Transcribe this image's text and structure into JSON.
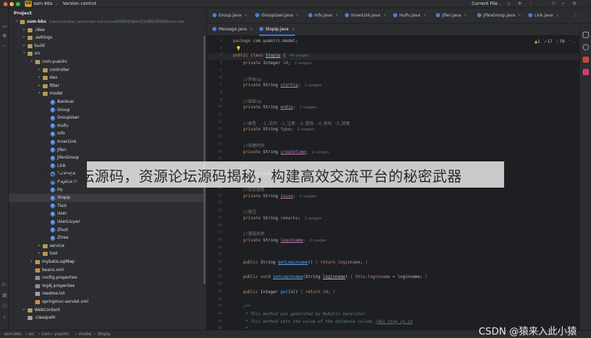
{
  "titlebar": {
    "project_badge": "SB",
    "project_name": "ssm-bbs",
    "vcs": "Version control",
    "run_config": "Current File"
  },
  "project_panel": {
    "title": "Project",
    "rows": [
      {
        "label": "ssm-bbs",
        "path": "/Library/eclipse_space/ssp+vue+mysql实现的在线bbs论坛源码/项目源码/ssm-bbs",
        "kind": "folder",
        "depth": 0,
        "open": true
      },
      {
        "label": ".idea",
        "kind": "folder",
        "depth": 1,
        "open": false
      },
      {
        "label": ".settings",
        "kind": "folder",
        "depth": 1,
        "open": false
      },
      {
        "label": "build",
        "kind": "folder",
        "depth": 1,
        "open": false
      },
      {
        "label": "src",
        "kind": "folder",
        "depth": 1,
        "open": true
      },
      {
        "label": "com.yuanlrc",
        "kind": "folder",
        "depth": 2,
        "open": true
      },
      {
        "label": "controller",
        "kind": "folder",
        "depth": 3,
        "open": false
      },
      {
        "label": "dao",
        "kind": "folder",
        "depth": 3,
        "open": false
      },
      {
        "label": "filter",
        "kind": "folder",
        "depth": 3,
        "open": false
      },
      {
        "label": "model",
        "kind": "folder",
        "depth": 3,
        "open": true
      },
      {
        "label": "Bankuai",
        "kind": "class",
        "depth": 4
      },
      {
        "label": "Group",
        "kind": "class",
        "depth": 4
      },
      {
        "label": "GroupUser",
        "kind": "class",
        "depth": 4
      },
      {
        "label": "Huifu",
        "kind": "class",
        "depth": 4
      },
      {
        "label": "info",
        "kind": "class",
        "depth": 4
      },
      {
        "label": "InnerLink",
        "kind": "class",
        "depth": 4
      },
      {
        "label": "Jifen",
        "kind": "class",
        "depth": 4
      },
      {
        "label": "JifenGroup",
        "kind": "class",
        "depth": 4
      },
      {
        "label": "Link",
        "kind": "class",
        "depth": 4
      },
      {
        "label": "Message",
        "kind": "class",
        "depth": 4
      },
      {
        "label": "PageBean",
        "kind": "class",
        "depth": 4
      },
      {
        "label": "Pic",
        "kind": "class",
        "depth": 4
      },
      {
        "label": "Stopip",
        "kind": "class",
        "depth": 4,
        "selected": true
      },
      {
        "label": "Tiezi",
        "kind": "class",
        "depth": 4
      },
      {
        "label": "User",
        "kind": "class",
        "depth": 4
      },
      {
        "label": "UserLiuyan",
        "kind": "class",
        "depth": 4
      },
      {
        "label": "Zhuti",
        "kind": "class",
        "depth": 4
      },
      {
        "label": "Ztree",
        "kind": "class",
        "depth": 4
      },
      {
        "label": "service",
        "kind": "folder",
        "depth": 3,
        "open": false
      },
      {
        "label": "tool",
        "kind": "folder",
        "depth": 3,
        "open": false
      },
      {
        "label": "mybatis.sqlMap",
        "kind": "folder",
        "depth": 2,
        "open": false
      },
      {
        "label": "beans.xml",
        "kind": "xml",
        "depth": 2
      },
      {
        "label": "config.properties",
        "kind": "prop",
        "depth": 2
      },
      {
        "label": "log4j.properties",
        "kind": "prop",
        "depth": 2
      },
      {
        "label": "readme.txt",
        "kind": "txt",
        "depth": 2
      },
      {
        "label": "springmvc-servlet.xml",
        "kind": "xml",
        "depth": 2
      },
      {
        "label": "WebContent",
        "kind": "folder",
        "depth": 1,
        "open": false
      },
      {
        "label": ".classpath",
        "kind": "txt",
        "depth": 1
      }
    ]
  },
  "tabs_row1": [
    "Group.java",
    "GroupUser.java",
    "Info.java",
    "InnerLink.java",
    "Huifu.java",
    "Jifen.java",
    "JifenGroup.java",
    "Link.java"
  ],
  "tabs_row2": [
    {
      "label": "Message.java",
      "active": false
    },
    {
      "label": "Stopip.java",
      "active": true
    }
  ],
  "inspections": {
    "warnings": "1",
    "weak": "17",
    "typos": "79"
  },
  "code_lines": [
    {
      "n": "1",
      "html": "<span class=\"kw\">package</span> com.yuanlrc.model;"
    },
    {
      "n": "2",
      "html": ""
    },
    {
      "n": "3",
      "html": "<span class=\"kw\">public class</span> <span class=\"ul\">Stopip</span> {<span class=\"hint\">40 usages</span>"
    },
    {
      "n": "4",
      "html": "    <span class=\"kw\">private</span> Integer <span class=\"fd\">id</span>;<span class=\"hint\">2 usages</span>"
    },
    {
      "n": "5",
      "html": ""
    },
    {
      "n": "6",
      "html": "    <span class=\"cm\">//开始ip</span>"
    },
    {
      "n": "7",
      "html": "    <span class=\"kw\">private</span> String <span class=\"fd ul\">startip</span>;<span class=\"hint\">2 usages</span>"
    },
    {
      "n": "8",
      "html": ""
    },
    {
      "n": "9",
      "html": "    <span class=\"cm\">//结束ip</span>"
    },
    {
      "n": "10",
      "html": "    <span class=\"kw\">private</span> String <span class=\"fd ul\">endip</span>;<span class=\"hint\">2 usages</span>"
    },
    {
      "n": "11",
      "html": ""
    },
    {
      "n": "12",
      "html": "    <span class=\"cm\">//类型  -1,访问 -2,注册 -3,登陆 -4,发帖 -5,回复</span>"
    },
    {
      "n": "13",
      "html": "    <span class=\"kw\">private</span> String <span class=\"fd\">type</span>;<span class=\"hint\">2 usages</span>"
    },
    {
      "n": "14",
      "html": ""
    },
    {
      "n": "15",
      "html": "    <span class=\"cm\">//创建时间</span>"
    },
    {
      "n": "16",
      "html": "    <span class=\"kw\">private</span> String <span class=\"fd ul\">createtime</span>;<span class=\"hint\">2 usages</span>"
    },
    {
      "n": "17",
      "html": ""
    },
    {
      "n": "18",
      "html": "    <span class=\"cm\">//</span>"
    },
    {
      "n": "19",
      "html": "    <span class=\"kw\">private</span> Integer <span class=\"fd\">userid</span>;<span class=\"hint\">2 usages</span>"
    },
    {
      "n": "20",
      "html": ""
    },
    {
      "n": "21",
      "html": "    <span class=\"cm\">//是否使用</span>"
    },
    {
      "n": "22",
      "html": "    <span class=\"kw\">private</span> String <span class=\"fd ul\">isuse</span>;<span class=\"hint\">2 usages</span>"
    },
    {
      "n": "23",
      "html": ""
    },
    {
      "n": "24",
      "html": "    <span class=\"cm\">//备注</span>"
    },
    {
      "n": "25",
      "html": "    <span class=\"kw\">private</span> String <span class=\"fd\">remarks</span>;<span class=\"hint\">2 usages</span>"
    },
    {
      "n": "26",
      "html": ""
    },
    {
      "n": "27",
      "html": "    <span class=\"cm\">//登陆名称</span>"
    },
    {
      "n": "28",
      "html": "    <span class=\"kw\">private</span> String <span class=\"fd ul\">loginname</span>;<span class=\"hint\">2 usages</span>"
    },
    {
      "n": "29",
      "html": ""
    },
    {
      "n": "30",
      "html": ""
    },
    {
      "n": "31",
      "html": "    <span class=\"kw\">public</span> String <span class=\"fn ul\">getLoginname</span>() <span class=\"fold\">{</span> <span class=\"kw\">return</span> <span class=\"fd\">loginname</span>; <span class=\"fold\">}</span>"
    },
    {
      "n": "34",
      "html": ""
    },
    {
      "n": "35",
      "html": "    <span class=\"kw\">public void</span> <span class=\"fn ul\">setLoginname</span>(String <span class=\"ul\">loginname</span>) <span class=\"fold\">{</span> <span class=\"kw\">this</span>.<span class=\"fd\">loginname</span> = loginname; <span class=\"fold\">}</span>"
    },
    {
      "n": "38",
      "html": ""
    },
    {
      "n": "39",
      "html": "    <span class=\"kw\">public</span> Integer <span class=\"fn\">getId</span>() <span class=\"fold\">{</span> <span class=\"kw\">return</span> <span class=\"fd\">id</span>; <span class=\"fold\">}</span>"
    },
    {
      "n": "42",
      "html": ""
    },
    {
      "n": "43",
      "html": "    <span class=\"dc\">/**</span>"
    },
    {
      "n": "44",
      "html": "<span class=\"dc\">     * This method was generated by MyBatis Generator.</span>"
    },
    {
      "n": "45",
      "html": "<span class=\"dc\">     * This method sets the value of the database column <span class=\"ul\">jdbs_stop_ip.id</span></span>"
    },
    {
      "n": "46",
      "html": "<span class=\"dc\">     *</span>"
    }
  ],
  "statusbar": {
    "crumbs": [
      "ssm-bbs",
      "src",
      "com",
      "yuanlrc",
      "model",
      "Stopip"
    ]
  },
  "overlay": {
    "text": "资源论坛源码，资源论坛源码揭秘，构建高效交流平台的秘密武器"
  },
  "watermark": "CSDN @猿来入此小猿",
  "colors": {
    "accent": "#3574f0",
    "class_icon": "#4c7fd6",
    "folder": "#b59a5a"
  }
}
